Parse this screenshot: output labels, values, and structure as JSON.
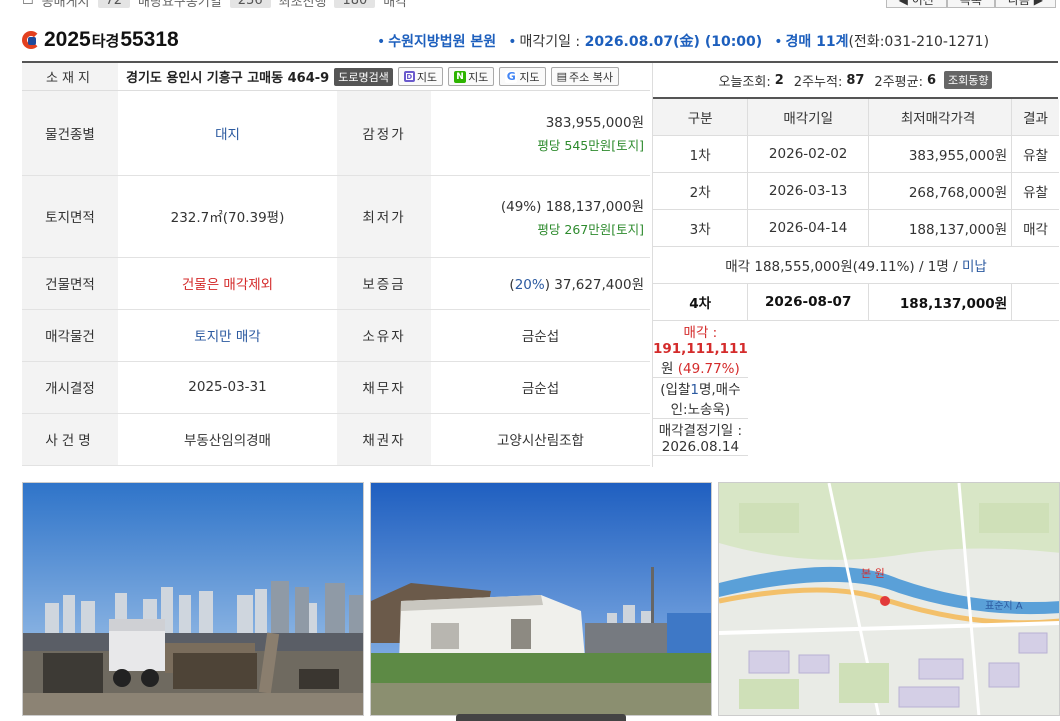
{
  "top": {
    "items": [
      {
        "label": "공매게시",
        "count": "72"
      },
      {
        "label": "배당요구종기일",
        "count": "236"
      },
      {
        "label": "최초진행",
        "count": "180"
      },
      {
        "label": "매각",
        "count": ""
      }
    ],
    "prev_label": "◀ 이전",
    "list_label": "목록",
    "next_label": "다음 ▶"
  },
  "header": {
    "year": "2025",
    "type": "타경",
    "number": "55318",
    "court": "수원지방법원 본원",
    "sale_label": "매각기일 : ",
    "sale_date": "2026.08.07(金) (10:00)",
    "dept_label": "경매 11계",
    "phone": "(전화:031-210-1271)"
  },
  "address": {
    "label": "소재지",
    "value": "경기도 용인시 기흥구 고매동 464-9",
    "road_btn": "도로명검색",
    "daum_map": "지도",
    "naver_map": "지도",
    "google_map": "지도",
    "copy_btn": "주소 복사"
  },
  "rows": [
    {
      "l1": "물건종별",
      "v1": "대지",
      "l2": "감정가",
      "v2a": "383,955,000원",
      "v2b": "평당 545만원[토지]"
    },
    {
      "l1": "토지면적",
      "v1": "232.7㎡(70.39평)",
      "l2": "최저가",
      "v2a": "(49%) 188,137,000원",
      "v2b": "평당 267만원[토지]"
    },
    {
      "l1": "건물면적",
      "v1": "건물은 매각제외",
      "l2": "보증금",
      "v2pct": "20%",
      "v2a": "37,627,400원"
    },
    {
      "l1": "매각물건",
      "v1": "토지만 매각",
      "l2": "소유자",
      "v2a": "금순섭"
    },
    {
      "l1": "개시결정",
      "v1": "2025-03-31",
      "l2": "채무자",
      "v2a": "금순섭"
    },
    {
      "l1": "사건명",
      "v1": "부동산임의경매",
      "l2": "채권자",
      "v2a": "고양시산림조합"
    }
  ],
  "views": {
    "today_label": "오늘조회:",
    "today": "2",
    "week2_label": "2주누적:",
    "week2": "87",
    "avg_label": "2주평균:",
    "avg": "6",
    "trend_btn": "조회동향"
  },
  "history": {
    "headers": [
      "구분",
      "매각기일",
      "최저매각가격",
      "결과"
    ],
    "rows": [
      {
        "round": "1차",
        "date": "2026-02-02",
        "price": "383,955,000원",
        "result": "유찰"
      },
      {
        "round": "2차",
        "date": "2026-03-13",
        "price": "268,768,000원",
        "result": "유찰"
      },
      {
        "round": "3차",
        "date": "2026-04-14",
        "price": "188,137,000원",
        "result": "매각"
      }
    ],
    "sale_note_pre": "매각 188,555,000원(49.11%) / 1명 / ",
    "sale_note_link": "미납",
    "current": {
      "round": "4차",
      "date": "2026-08-07",
      "price": "188,137,000원"
    },
    "final_label": "매각 : ",
    "final_price": "191,111,111",
    "final_unit": "원",
    "final_pct": "(49.77%)",
    "bid_pre": "(입찰",
    "bid_count": "1",
    "bid_post": "명,매수인:노송욱)",
    "decision": "매각결정기일 : 2026.08.14"
  },
  "map_labels": {
    "place": "본 원",
    "station": "표순지 A"
  },
  "colors": {
    "accent_blue": "#1d5fbd",
    "red": "#d42b2b",
    "green": "#2e8b2e"
  }
}
